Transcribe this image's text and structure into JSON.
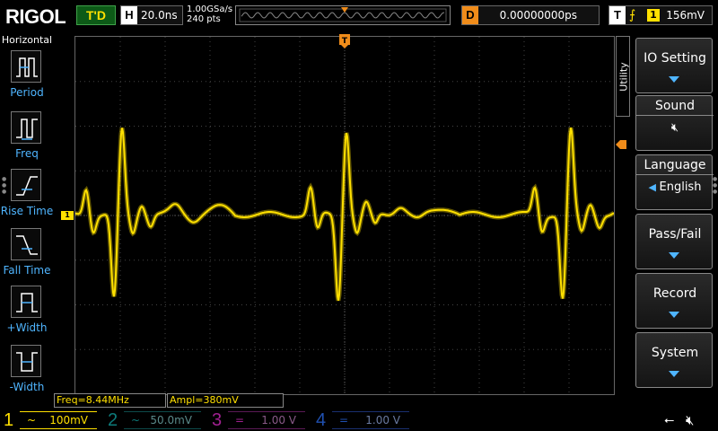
{
  "brand": "RIGOL",
  "top": {
    "trigger_status": "T'D",
    "horizontal_label": "H",
    "timebase": "20.0ns",
    "sample_rate": "1.00GSa/s",
    "memory_depth": "240  pts",
    "delay_label": "D",
    "delay_value": "0.00000000ps",
    "trigger_label": "T",
    "trigger_edge": "⨍",
    "trigger_source": "1",
    "trigger_level": "156mV"
  },
  "left_menu": {
    "title": "Horizontal",
    "items": [
      {
        "label": "Period"
      },
      {
        "label": "Freq"
      },
      {
        "label": "Rise Time"
      },
      {
        "label": "Fall Time"
      },
      {
        "label": "+Width"
      },
      {
        "label": "-Width"
      }
    ]
  },
  "measurements": {
    "freq": "Freq=8.44MHz",
    "ampl": "Ampl=380mV"
  },
  "right_menu": {
    "utility_tab": "Utility",
    "io_setting": "IO Setting",
    "sound_label": "Sound",
    "sound_icon": "speaker-mute-icon",
    "language_label": "Language",
    "language_value": "English",
    "pass_fail": "Pass/Fail",
    "record": "Record",
    "system": "System"
  },
  "channels": [
    {
      "num": "1",
      "coupling": "~",
      "scale": "100mV",
      "color": "#ffe000",
      "active": true
    },
    {
      "num": "2",
      "coupling": "~",
      "scale": "50.0mV",
      "color": "#0d7a7a",
      "active": false
    },
    {
      "num": "3",
      "coupling": "=",
      "scale": "1.00 V",
      "color": "#a02090",
      "active": false
    },
    {
      "num": "4",
      "coupling": "=",
      "scale": "1.00 V",
      "color": "#2050b0",
      "active": false
    }
  ],
  "colors": {
    "ch1": "#ffe000",
    "trigger": "#f08c1a",
    "menu_accent": "#4fb5ff"
  }
}
